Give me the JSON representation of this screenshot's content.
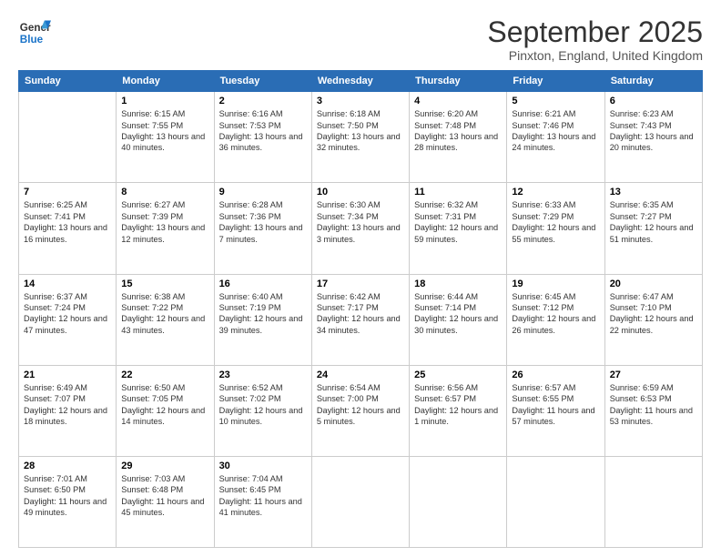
{
  "logo": {
    "line1": "General",
    "line2": "Blue"
  },
  "title": "September 2025",
  "location": "Pinxton, England, United Kingdom",
  "weekdays": [
    "Sunday",
    "Monday",
    "Tuesday",
    "Wednesday",
    "Thursday",
    "Friday",
    "Saturday"
  ],
  "weeks": [
    [
      {
        "day": null
      },
      {
        "day": 1,
        "sunrise": "6:15 AM",
        "sunset": "7:55 PM",
        "daylight": "13 hours and 40 minutes."
      },
      {
        "day": 2,
        "sunrise": "6:16 AM",
        "sunset": "7:53 PM",
        "daylight": "13 hours and 36 minutes."
      },
      {
        "day": 3,
        "sunrise": "6:18 AM",
        "sunset": "7:50 PM",
        "daylight": "13 hours and 32 minutes."
      },
      {
        "day": 4,
        "sunrise": "6:20 AM",
        "sunset": "7:48 PM",
        "daylight": "13 hours and 28 minutes."
      },
      {
        "day": 5,
        "sunrise": "6:21 AM",
        "sunset": "7:46 PM",
        "daylight": "13 hours and 24 minutes."
      },
      {
        "day": 6,
        "sunrise": "6:23 AM",
        "sunset": "7:43 PM",
        "daylight": "13 hours and 20 minutes."
      }
    ],
    [
      {
        "day": 7,
        "sunrise": "6:25 AM",
        "sunset": "7:41 PM",
        "daylight": "13 hours and 16 minutes."
      },
      {
        "day": 8,
        "sunrise": "6:27 AM",
        "sunset": "7:39 PM",
        "daylight": "13 hours and 12 minutes."
      },
      {
        "day": 9,
        "sunrise": "6:28 AM",
        "sunset": "7:36 PM",
        "daylight": "13 hours and 7 minutes."
      },
      {
        "day": 10,
        "sunrise": "6:30 AM",
        "sunset": "7:34 PM",
        "daylight": "13 hours and 3 minutes."
      },
      {
        "day": 11,
        "sunrise": "6:32 AM",
        "sunset": "7:31 PM",
        "daylight": "12 hours and 59 minutes."
      },
      {
        "day": 12,
        "sunrise": "6:33 AM",
        "sunset": "7:29 PM",
        "daylight": "12 hours and 55 minutes."
      },
      {
        "day": 13,
        "sunrise": "6:35 AM",
        "sunset": "7:27 PM",
        "daylight": "12 hours and 51 minutes."
      }
    ],
    [
      {
        "day": 14,
        "sunrise": "6:37 AM",
        "sunset": "7:24 PM",
        "daylight": "12 hours and 47 minutes."
      },
      {
        "day": 15,
        "sunrise": "6:38 AM",
        "sunset": "7:22 PM",
        "daylight": "12 hours and 43 minutes."
      },
      {
        "day": 16,
        "sunrise": "6:40 AM",
        "sunset": "7:19 PM",
        "daylight": "12 hours and 39 minutes."
      },
      {
        "day": 17,
        "sunrise": "6:42 AM",
        "sunset": "7:17 PM",
        "daylight": "12 hours and 34 minutes."
      },
      {
        "day": 18,
        "sunrise": "6:44 AM",
        "sunset": "7:14 PM",
        "daylight": "12 hours and 30 minutes."
      },
      {
        "day": 19,
        "sunrise": "6:45 AM",
        "sunset": "7:12 PM",
        "daylight": "12 hours and 26 minutes."
      },
      {
        "day": 20,
        "sunrise": "6:47 AM",
        "sunset": "7:10 PM",
        "daylight": "12 hours and 22 minutes."
      }
    ],
    [
      {
        "day": 21,
        "sunrise": "6:49 AM",
        "sunset": "7:07 PM",
        "daylight": "12 hours and 18 minutes."
      },
      {
        "day": 22,
        "sunrise": "6:50 AM",
        "sunset": "7:05 PM",
        "daylight": "12 hours and 14 minutes."
      },
      {
        "day": 23,
        "sunrise": "6:52 AM",
        "sunset": "7:02 PM",
        "daylight": "12 hours and 10 minutes."
      },
      {
        "day": 24,
        "sunrise": "6:54 AM",
        "sunset": "7:00 PM",
        "daylight": "12 hours and 5 minutes."
      },
      {
        "day": 25,
        "sunrise": "6:56 AM",
        "sunset": "6:57 PM",
        "daylight": "12 hours and 1 minute."
      },
      {
        "day": 26,
        "sunrise": "6:57 AM",
        "sunset": "6:55 PM",
        "daylight": "11 hours and 57 minutes."
      },
      {
        "day": 27,
        "sunrise": "6:59 AM",
        "sunset": "6:53 PM",
        "daylight": "11 hours and 53 minutes."
      }
    ],
    [
      {
        "day": 28,
        "sunrise": "7:01 AM",
        "sunset": "6:50 PM",
        "daylight": "11 hours and 49 minutes."
      },
      {
        "day": 29,
        "sunrise": "7:03 AM",
        "sunset": "6:48 PM",
        "daylight": "11 hours and 45 minutes."
      },
      {
        "day": 30,
        "sunrise": "7:04 AM",
        "sunset": "6:45 PM",
        "daylight": "11 hours and 41 minutes."
      },
      {
        "day": null
      },
      {
        "day": null
      },
      {
        "day": null
      },
      {
        "day": null
      }
    ]
  ]
}
